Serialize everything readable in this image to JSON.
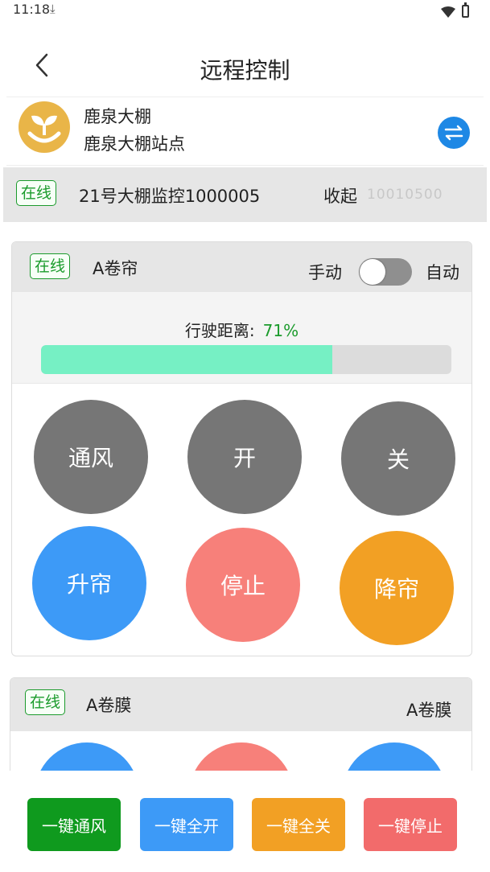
{
  "status_bar": {
    "time": "11:18",
    "download_icon": "download-icon",
    "wifi_icon": "wifi-icon",
    "battery_icon": "battery-icon"
  },
  "nav": {
    "back_icon": "chevron-left-icon",
    "title": "远程控制"
  },
  "site": {
    "name": "鹿泉大棚",
    "station": "鹿泉大棚站点",
    "avatar_icon": "sprout-logo",
    "switch_icon": "swap-arrows-icon"
  },
  "device": {
    "status": "在线",
    "name": "21号大棚监控1000005",
    "collapse_label": "收起",
    "collapse_extra": "10010500"
  },
  "curtain": {
    "status": "在线",
    "title": "A卷帘",
    "mode_manual": "手动",
    "mode_auto": "自动",
    "auto_enabled": false,
    "progress_label": "行驶距离:",
    "progress_text": "71%",
    "progress": 0.71,
    "buttons": {
      "ventilate": "通风",
      "open": "开",
      "close": "关",
      "raise": "升帘",
      "stop": "停止",
      "lower": "降帘"
    }
  },
  "film": {
    "status": "在线",
    "title": "A卷膜",
    "right_label": "A卷膜"
  },
  "actions": {
    "ventilate_all": "一键通风",
    "open_all": "一键全开",
    "close_all": "一键全关",
    "stop_all": "一键停止"
  },
  "colors": {
    "online_green": "#1b9b2c",
    "gray_button": "#767676",
    "blue_button": "#3d9af7",
    "pink_button": "#f7807a",
    "orange_button": "#f2a024",
    "progress_fill": "#76f0c4",
    "action_green": "#0f9a1e",
    "action_blue": "#3d9af7",
    "action_orange": "#f2a024",
    "action_red": "#f26b6b"
  }
}
